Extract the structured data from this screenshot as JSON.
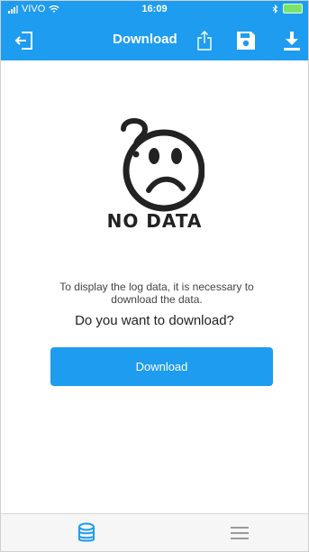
{
  "status": {
    "carrier": "VIVO",
    "time": "16:09"
  },
  "nav": {
    "title": "Download"
  },
  "content": {
    "no_data": "NO DATA",
    "message": "To display the log data, it is necessary to download the data.",
    "question": "Do you want to download?",
    "download_button": "Download"
  },
  "colors": {
    "accent": "#1e9cf0",
    "battery": "#7be36c"
  },
  "icons": {
    "logout": "logout-icon",
    "share": "share-icon",
    "save": "save-icon",
    "download": "download-icon",
    "database": "database-icon",
    "menu": "menu-icon"
  }
}
